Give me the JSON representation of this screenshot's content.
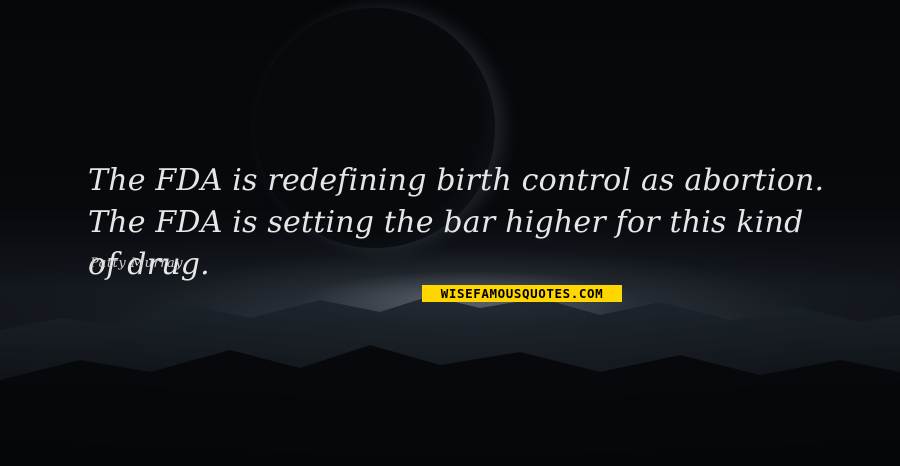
{
  "quote": {
    "text": "The FDA is redefining birth control as abortion. The FDA is setting the bar higher for this kind of drug.",
    "author": "Patty Murray"
  },
  "brand": {
    "logo_text": "WISEFAMOUSQUOTES.COM"
  },
  "colors": {
    "background": "#050608",
    "quote_text": "#e6e6e6",
    "brand_background": "#ffd600",
    "brand_text": "#000000"
  }
}
